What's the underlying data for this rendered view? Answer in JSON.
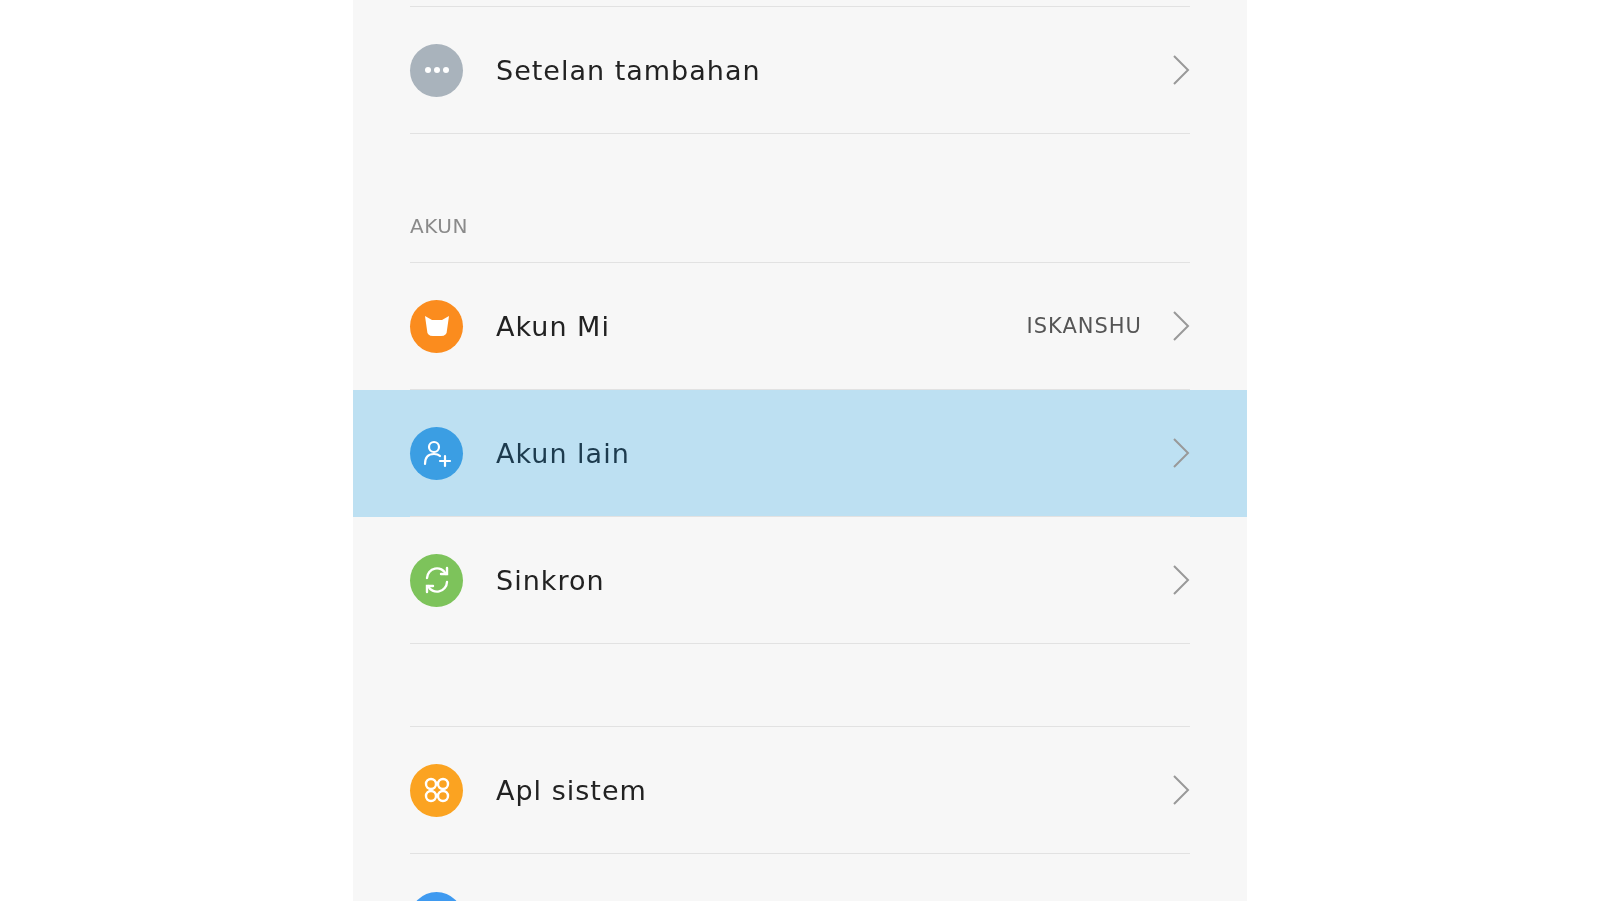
{
  "groups": [
    {
      "items": [
        {
          "label": "Setelan tambahan",
          "color": "#a9b3bc",
          "selected": false
        }
      ]
    },
    {
      "header": "AKUN",
      "items": [
        {
          "label": "Akun Mi",
          "value": "ISKANSHU",
          "color": "#fb8c1e",
          "selected": false
        },
        {
          "label": "Akun lain",
          "color": "#3b9ee3",
          "selected": true
        },
        {
          "label": "Sinkron",
          "color": "#7dc35b",
          "selected": false
        }
      ]
    },
    {
      "items": [
        {
          "label": "Apl sistem",
          "color": "#fba321",
          "selected": false
        },
        {
          "kind": "partial",
          "color": "#3f9af0"
        }
      ]
    }
  ]
}
